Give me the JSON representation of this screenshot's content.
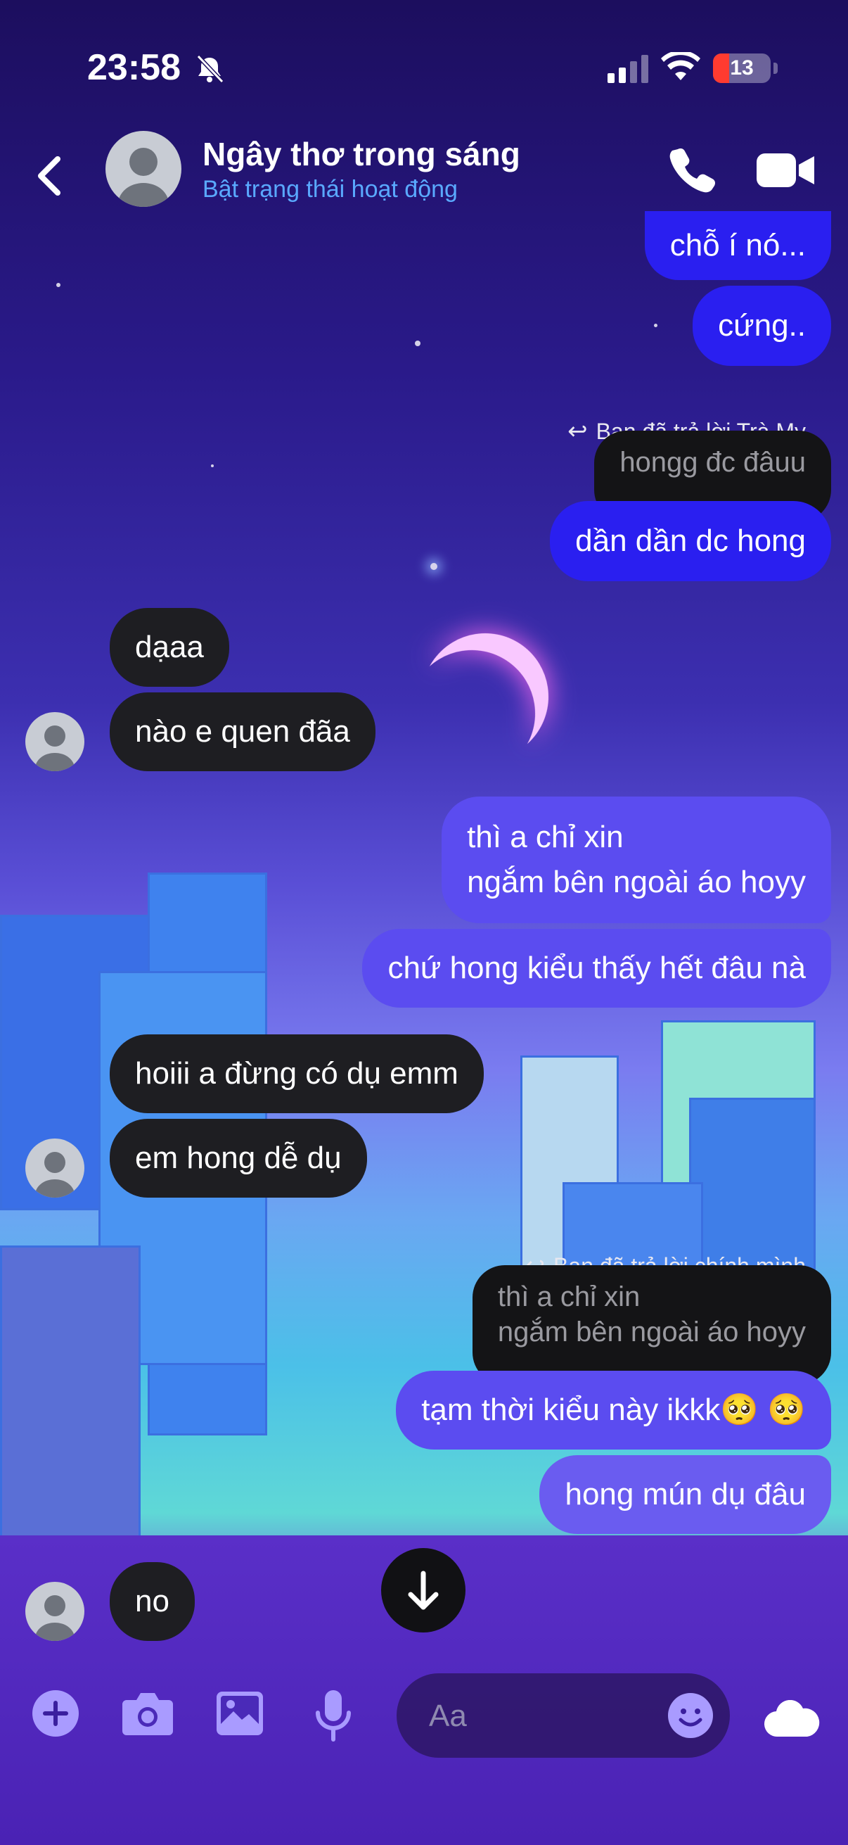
{
  "status_bar": {
    "time": "23:58",
    "battery": "13"
  },
  "header": {
    "contact_name": "Ngây thơ trong sáng",
    "contact_status": "Bật trạng thái hoạt động"
  },
  "messages": {
    "m1": "chỗ í nó...",
    "m2": "cứng..",
    "reply_label_1": "Bạn đã trả lời Trà My",
    "reply_preview_1": "hongg đc đâuu",
    "m3": "dần dần dc hong",
    "m4": "dạaa",
    "m5": "nào e quen đãa",
    "m6": "thì a chỉ xin\nngắm bên ngoài áo hoyy",
    "m7": "chứ hong kiểu thấy hết đâu nà",
    "m8": "hoiii a đừng có dụ emm",
    "m9": "em hong dễ dụ",
    "reply_label_2": "Bạn đã trả lời chính mình",
    "reply_preview_2": "thì a chỉ xin\nngắm bên ngoài áo hoyy",
    "m10": "tạm thời kiểu này ikkk🥺 🥺",
    "m11": "hong mún dụ đâu",
    "m12": "no"
  },
  "composer": {
    "placeholder": "Aa"
  },
  "colors": {
    "outgoing_bubble": "#5b4cf0",
    "incoming_bubble": "#1e1e22",
    "status_link": "#5aa9ff"
  }
}
